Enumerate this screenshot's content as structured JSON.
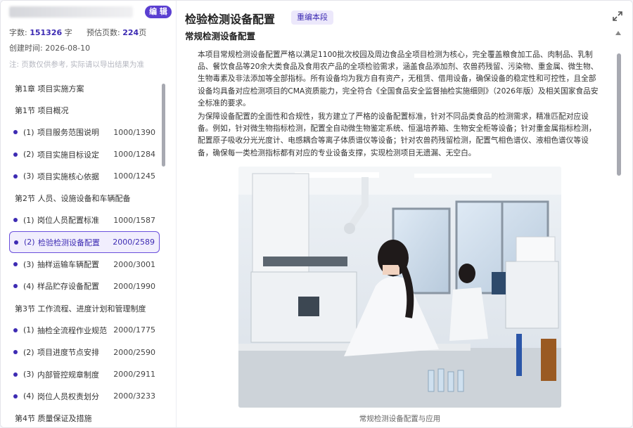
{
  "sidebar": {
    "edit_label": "编 辑",
    "word_count_label": "字数:",
    "word_count": "151326",
    "word_unit": "字",
    "pages_label": "预估页数:",
    "pages": "224",
    "pages_unit": "页",
    "created_label": "创建时间:",
    "created": "2026-08-10",
    "note": "注: 页数仅供参考, 实际请以导出结果为准",
    "toc": [
      {
        "type": "chapter",
        "label": "第1章   项目实施方案"
      },
      {
        "type": "chapter",
        "label": "第1节   项目概况"
      },
      {
        "type": "sub",
        "num": "(1)",
        "label": "项目服务范围说明",
        "count": "1000/1390"
      },
      {
        "type": "sub",
        "num": "(2)",
        "label": "项目实施目标设定",
        "count": "1000/1284"
      },
      {
        "type": "sub",
        "num": "(3)",
        "label": "项目实施核心依据",
        "count": "1000/1245"
      },
      {
        "type": "chapter",
        "label": "第2节   人员、设施设备和车辆配备"
      },
      {
        "type": "sub",
        "num": "(1)",
        "label": "岗位人员配置标准",
        "count": "1000/1587"
      },
      {
        "type": "sub",
        "num": "(2)",
        "label": "检验检测设备配置",
        "count": "2000/2589",
        "active": true
      },
      {
        "type": "sub",
        "num": "(3)",
        "label": "抽样运输车辆配置",
        "count": "2000/3001"
      },
      {
        "type": "sub",
        "num": "(4)",
        "label": "样品贮存设备配置",
        "count": "2000/1990"
      },
      {
        "type": "chapter",
        "label": "第3节   工作流程、进度计划和管理制度"
      },
      {
        "type": "sub",
        "num": "(1)",
        "label": "抽检全流程作业规范",
        "count": "2000/1775"
      },
      {
        "type": "sub",
        "num": "(2)",
        "label": "项目进度节点安排",
        "count": "2000/2590"
      },
      {
        "type": "sub",
        "num": "(3)",
        "label": "内部管控规章制度",
        "count": "2000/2911"
      },
      {
        "type": "sub",
        "num": "(4)",
        "label": "岗位人员权责划分",
        "count": "2000/3233"
      },
      {
        "type": "chapter",
        "label": "第4节   质量保证及措施"
      }
    ]
  },
  "main": {
    "title": "检验检测设备配置",
    "reedit_label": "重编本段",
    "subtitle": "常规检测设备配置",
    "para1": "本项目常规检测设备配置严格以满足1100批次校园及周边食品全项目检测为核心，完全覆盖粮食加工品、肉制品、乳制品、餐饮食品等20余大类食品及食用农产品的全项检验需求，涵盖食品添加剂、农兽药残留、污染物、重金属、微生物、生物毒素及非法添加等全部指标。所有设备均为我方自有资产，无租赁、借用设备，确保设备的稳定性和可控性，且全部设备均具备对应检测项目的CMA资质能力，完全符合《全国食品安全监督抽检实施细则》（2026年版）及相关国家食品安全标准的要求。",
    "para2": "为保障设备配置的全面性和合规性，我方建立了严格的设备配置标准，针对不同品类食品的检测需求，精准匹配对应设备。例如，针对微生物指标检测，配置全自动微生物鉴定系统、恒温培养箱、生物安全柜等设备；针对重金属指标检测，配置原子吸收分光光度计、电感耦合等离子体质谱仪等设备；针对农兽药残留检测，配置气相色谱仪、液相色谱仪等设备，确保每一类检测指标都有对应的专业设备支撑，实现检测项目无遗漏、无空白。",
    "caption": "常规检测设备配置与应用"
  },
  "colors": {
    "accent": "#5b3fd1",
    "accent_text": "#3d2bb3",
    "active_bg": "#f1eefd"
  }
}
